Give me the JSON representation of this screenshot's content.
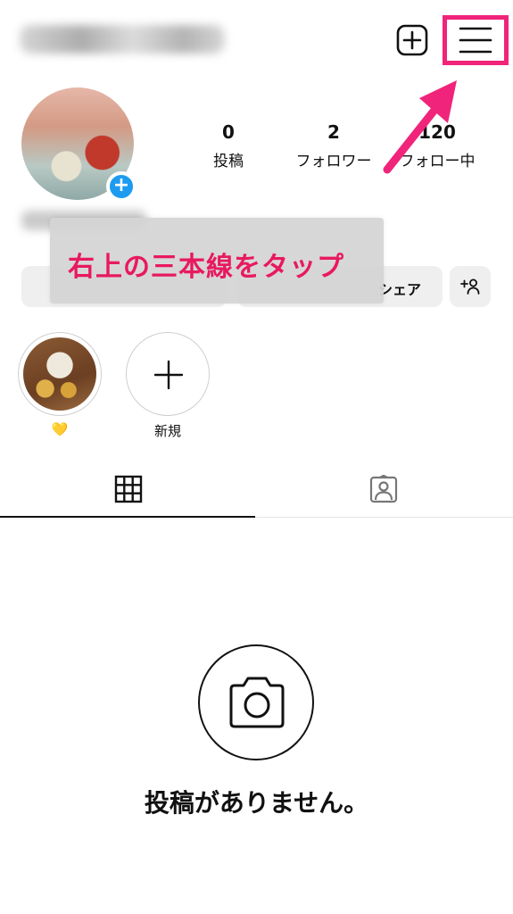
{
  "header": {
    "add_icon": "plus-square-icon",
    "menu_icon": "hamburger-menu-icon"
  },
  "profile": {
    "stats": [
      {
        "value": "0",
        "label": "投稿"
      },
      {
        "value": "2",
        "label": "フォロワー"
      },
      {
        "value": "120",
        "label": "フォロー中"
      }
    ],
    "share_label": "シェア",
    "add_user_icon": "add-user-icon"
  },
  "callout": {
    "text": "右上の三本線をタップ",
    "color": "#e8195f"
  },
  "highlights": [
    {
      "label": "💛"
    },
    {
      "label": "新規"
    }
  ],
  "tabs": {
    "grid_icon": "grid-icon",
    "tagged_icon": "tagged-person-icon"
  },
  "empty_state": {
    "icon": "camera-icon",
    "text": "投稿がありません。"
  },
  "colors": {
    "highlight_border": "#f0247a",
    "avatar_badge": "#1d9bf0"
  }
}
